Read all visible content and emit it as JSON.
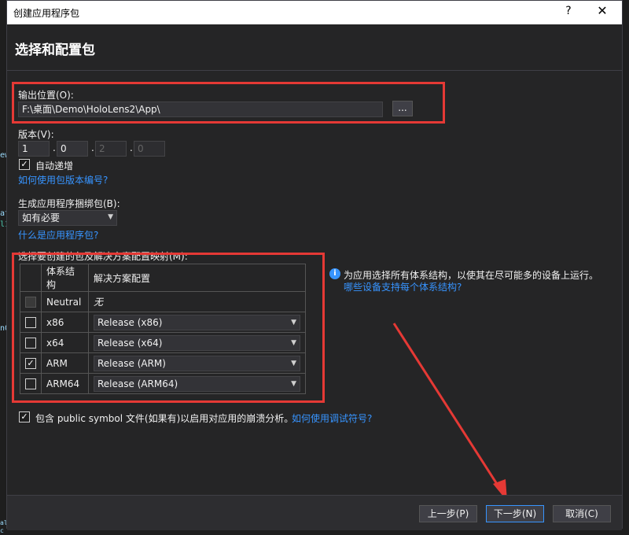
{
  "window": {
    "title": "创建应用程序包",
    "help_label": "?",
    "close_label": "✕"
  },
  "heading": "选择和配置包",
  "output": {
    "label": "输出位置(O):",
    "value": "F:\\桌面\\Demo\\HoloLens2\\App\\",
    "browse_label": "..."
  },
  "version": {
    "label": "版本(V):",
    "major": "1",
    "minor": "0",
    "build": "2",
    "revision": "0",
    "auto_increment_label": "自动递增",
    "auto_increment_checked": true,
    "help_link": "如何使用包版本编号?"
  },
  "bundle": {
    "label": "生成应用程序捆绑包(B):",
    "selected": "如有必要",
    "help_link": "什么是应用程序包?"
  },
  "packages": {
    "label": "选择要创建的包及解决方案配置映射(M):",
    "columns": [
      "体系结构",
      "解决方案配置"
    ],
    "rows": [
      {
        "arch": "Neutral",
        "config": "无",
        "checked": false,
        "disabled": true
      },
      {
        "arch": "x86",
        "config": "Release (x86)",
        "checked": false,
        "disabled": false
      },
      {
        "arch": "x64",
        "config": "Release (x64)",
        "checked": false,
        "disabled": false
      },
      {
        "arch": "ARM",
        "config": "Release (ARM)",
        "checked": true,
        "disabled": false
      },
      {
        "arch": "ARM64",
        "config": "Release (ARM64)",
        "checked": false,
        "disabled": false
      }
    ]
  },
  "info": {
    "icon": "info-icon",
    "text": "为应用选择所有体系结构，以使其在尽可能多的设备上运行。",
    "link": "哪些设备支持每个体系结构?"
  },
  "symbols": {
    "checked": true,
    "label": "包含 public symbol 文件(如果有)以启用对应用的崩溃分析。",
    "link": "如何使用调试符号?"
  },
  "footer": {
    "back_label": "上一步(P)",
    "next_label": "下一步(N)",
    "cancel_label": "取消(C)"
  },
  "background_fragments": [
    "ew",
    "at",
    "l1",
    "n0",
    "al",
    "c"
  ],
  "colors": {
    "accent": "#3794ff",
    "highlight": "#e53935",
    "dialog_bg": "#252526"
  }
}
